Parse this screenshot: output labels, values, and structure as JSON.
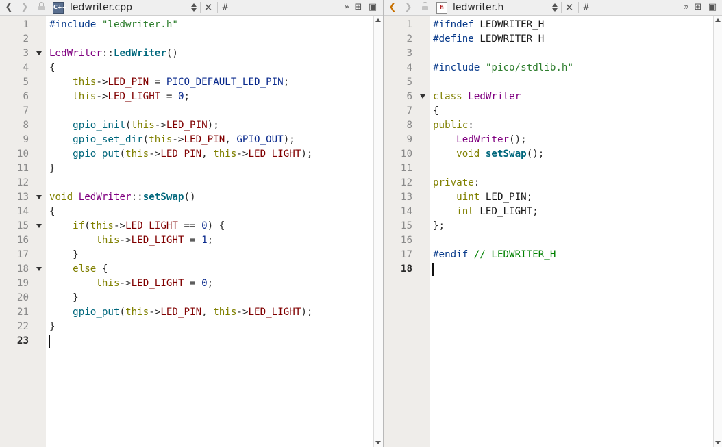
{
  "left_pane": {
    "filename": "ledwriter.cpp",
    "file_icon": "cpp-file-icon",
    "symbol_label": "#",
    "lines": [
      [
        [
          "pp",
          "#include "
        ],
        [
          "str",
          "\"ledwriter.h\""
        ]
      ],
      [],
      [
        [
          "cls",
          "LedWriter"
        ],
        [
          "op",
          "::"
        ],
        [
          "fn",
          "LedWriter"
        ],
        [
          "op",
          "()"
        ]
      ],
      [
        [
          "op",
          "{"
        ]
      ],
      [
        [
          "id",
          "    "
        ],
        [
          "kw",
          "this"
        ],
        [
          "op",
          "->"
        ],
        [
          "mem",
          "LED_PIN"
        ],
        [
          "op",
          " = "
        ],
        [
          "mac",
          "PICO_DEFAULT_LED_PIN"
        ],
        [
          "op",
          ";"
        ]
      ],
      [
        [
          "id",
          "    "
        ],
        [
          "kw",
          "this"
        ],
        [
          "op",
          "->"
        ],
        [
          "mem",
          "LED_LIGHT"
        ],
        [
          "op",
          " = "
        ],
        [
          "num",
          "0"
        ],
        [
          "op",
          ";"
        ]
      ],
      [],
      [
        [
          "id",
          "    "
        ],
        [
          "fnc",
          "gpio_init"
        ],
        [
          "op",
          "("
        ],
        [
          "kw",
          "this"
        ],
        [
          "op",
          "->"
        ],
        [
          "mem",
          "LED_PIN"
        ],
        [
          "op",
          ");"
        ]
      ],
      [
        [
          "id",
          "    "
        ],
        [
          "fnc",
          "gpio_set_dir"
        ],
        [
          "op",
          "("
        ],
        [
          "kw",
          "this"
        ],
        [
          "op",
          "->"
        ],
        [
          "mem",
          "LED_PIN"
        ],
        [
          "op",
          ", "
        ],
        [
          "mac",
          "GPIO_OUT"
        ],
        [
          "op",
          ");"
        ]
      ],
      [
        [
          "id",
          "    "
        ],
        [
          "fnc",
          "gpio_put"
        ],
        [
          "op",
          "("
        ],
        [
          "kw",
          "this"
        ],
        [
          "op",
          "->"
        ],
        [
          "mem",
          "LED_PIN"
        ],
        [
          "op",
          ", "
        ],
        [
          "kw",
          "this"
        ],
        [
          "op",
          "->"
        ],
        [
          "mem",
          "LED_LIGHT"
        ],
        [
          "op",
          ");"
        ]
      ],
      [
        [
          "op",
          "}"
        ]
      ],
      [],
      [
        [
          "ty",
          "void "
        ],
        [
          "cls",
          "LedWriter"
        ],
        [
          "op",
          "::"
        ],
        [
          "fn",
          "setSwap"
        ],
        [
          "op",
          "()"
        ]
      ],
      [
        [
          "op",
          "{"
        ]
      ],
      [
        [
          "id",
          "    "
        ],
        [
          "kw",
          "if"
        ],
        [
          "op",
          "("
        ],
        [
          "kw",
          "this"
        ],
        [
          "op",
          "->"
        ],
        [
          "mem",
          "LED_LIGHT"
        ],
        [
          "op",
          " == "
        ],
        [
          "num",
          "0"
        ],
        [
          "op",
          ") {"
        ]
      ],
      [
        [
          "id",
          "        "
        ],
        [
          "kw",
          "this"
        ],
        [
          "op",
          "->"
        ],
        [
          "mem",
          "LED_LIGHT"
        ],
        [
          "op",
          " = "
        ],
        [
          "num",
          "1"
        ],
        [
          "op",
          ";"
        ]
      ],
      [
        [
          "id",
          "    "
        ],
        [
          "op",
          "}"
        ]
      ],
      [
        [
          "id",
          "    "
        ],
        [
          "kw",
          "else"
        ],
        [
          "op",
          " {"
        ]
      ],
      [
        [
          "id",
          "        "
        ],
        [
          "kw",
          "this"
        ],
        [
          "op",
          "->"
        ],
        [
          "mem",
          "LED_LIGHT"
        ],
        [
          "op",
          " = "
        ],
        [
          "num",
          "0"
        ],
        [
          "op",
          ";"
        ]
      ],
      [
        [
          "id",
          "    "
        ],
        [
          "op",
          "}"
        ]
      ],
      [
        [
          "id",
          "    "
        ],
        [
          "fnc",
          "gpio_put"
        ],
        [
          "op",
          "("
        ],
        [
          "kw",
          "this"
        ],
        [
          "op",
          "->"
        ],
        [
          "mem",
          "LED_PIN"
        ],
        [
          "op",
          ", "
        ],
        [
          "kw",
          "this"
        ],
        [
          "op",
          "->"
        ],
        [
          "mem",
          "LED_LIGHT"
        ],
        [
          "op",
          ");"
        ]
      ],
      [
        [
          "op",
          "}"
        ]
      ],
      []
    ],
    "fold_lines": [
      3,
      13,
      15,
      18
    ],
    "current_line": 23
  },
  "right_pane": {
    "filename": "ledwriter.h",
    "file_icon": "header-file-icon",
    "symbol_label": "#",
    "lines": [
      [
        [
          "pp",
          "#ifndef "
        ],
        [
          "id",
          "LEDWRITER_H"
        ]
      ],
      [
        [
          "pp",
          "#define "
        ],
        [
          "id",
          "LEDWRITER_H"
        ]
      ],
      [],
      [
        [
          "pp",
          "#include "
        ],
        [
          "str",
          "\"pico/stdlib.h\""
        ]
      ],
      [],
      [
        [
          "ty",
          "class "
        ],
        [
          "cls",
          "LedWriter"
        ]
      ],
      [
        [
          "op",
          "{"
        ]
      ],
      [
        [
          "kw",
          "public"
        ],
        [
          "op",
          ":"
        ]
      ],
      [
        [
          "id",
          "    "
        ],
        [
          "cls",
          "LedWriter"
        ],
        [
          "op",
          "();"
        ]
      ],
      [
        [
          "id",
          "    "
        ],
        [
          "ty",
          "void "
        ],
        [
          "fn",
          "setSwap"
        ],
        [
          "op",
          "();"
        ]
      ],
      [],
      [
        [
          "kw",
          "private"
        ],
        [
          "op",
          ":"
        ]
      ],
      [
        [
          "id",
          "    "
        ],
        [
          "ty",
          "uint "
        ],
        [
          "id",
          "LED_PIN;"
        ]
      ],
      [
        [
          "id",
          "    "
        ],
        [
          "ty",
          "int "
        ],
        [
          "id",
          "LED_LIGHT;"
        ]
      ],
      [
        [
          "op",
          "};"
        ]
      ],
      [],
      [
        [
          "pp",
          "#endif "
        ],
        [
          "cm",
          "// LEDWRITER_H"
        ]
      ],
      []
    ],
    "fold_lines": [
      6
    ],
    "current_line": 18
  }
}
